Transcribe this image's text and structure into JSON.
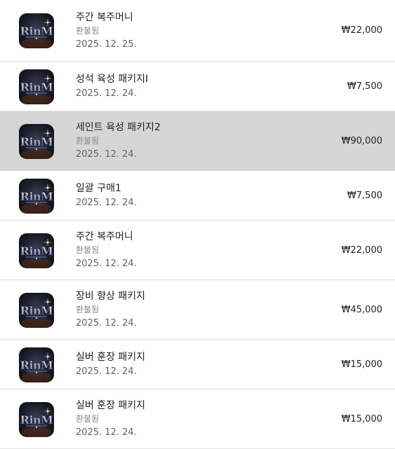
{
  "app": {
    "icon_name": "rinm-game-icon",
    "icon_text": "RinM"
  },
  "purchases": [
    {
      "name": "주간 복주머니",
      "status": "환불됨",
      "date": "2025. 12. 25.",
      "price": "₩22,000",
      "selected": false
    },
    {
      "name": "성석 육성 패키지I",
      "status": "",
      "date": "2025. 12. 24.",
      "price": "₩7,500",
      "selected": false
    },
    {
      "name": "세인트 육성 패키지2",
      "status": "환불됨",
      "date": "2025. 12. 24.",
      "price": "₩90,000",
      "selected": true
    },
    {
      "name": "일괄 구매1",
      "status": "",
      "date": "2025. 12. 24.",
      "price": "₩7,500",
      "selected": false
    },
    {
      "name": "주간 복주머니",
      "status": "환불됨",
      "date": "2025. 12. 24.",
      "price": "₩22,000",
      "selected": false
    },
    {
      "name": "장비 향상 패키지",
      "status": "환불됨",
      "date": "2025. 12. 24.",
      "price": "₩45,000",
      "selected": false
    },
    {
      "name": "실버 훈장 패키지",
      "status": "",
      "date": "2025. 12. 24.",
      "price": "₩15,000",
      "selected": false
    },
    {
      "name": "실버 훈장 패키지",
      "status": "환불됨",
      "date": "2025. 12. 24.",
      "price": "₩15,000",
      "selected": false
    }
  ],
  "colors": {
    "selected_row": "#d6d6d6",
    "divider": "#e0e0e0",
    "refund_text": "#80868b"
  }
}
